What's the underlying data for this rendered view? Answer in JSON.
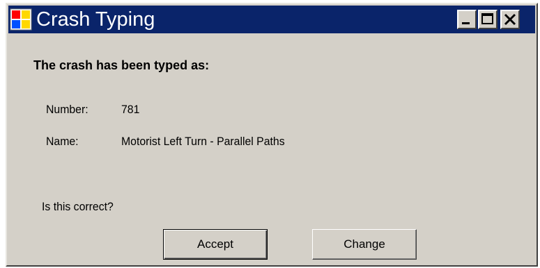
{
  "window": {
    "title": "Crash Typing",
    "icon": "app-grid-icon",
    "controls": [
      "minimize-icon",
      "maximize-icon",
      "close-icon"
    ]
  },
  "content": {
    "heading": "The crash has been typed as:",
    "number_label": "Number:",
    "number_value": "781",
    "name_label": "Name:",
    "name_value": "Motorist Left Turn - Parallel Paths",
    "question": "Is this correct?"
  },
  "buttons": {
    "accept_label": "Accept",
    "change_label": "Change"
  },
  "colors": {
    "titlebar": "#0a246a",
    "face": "#d4d0c8",
    "title_text": "#ffffff"
  }
}
